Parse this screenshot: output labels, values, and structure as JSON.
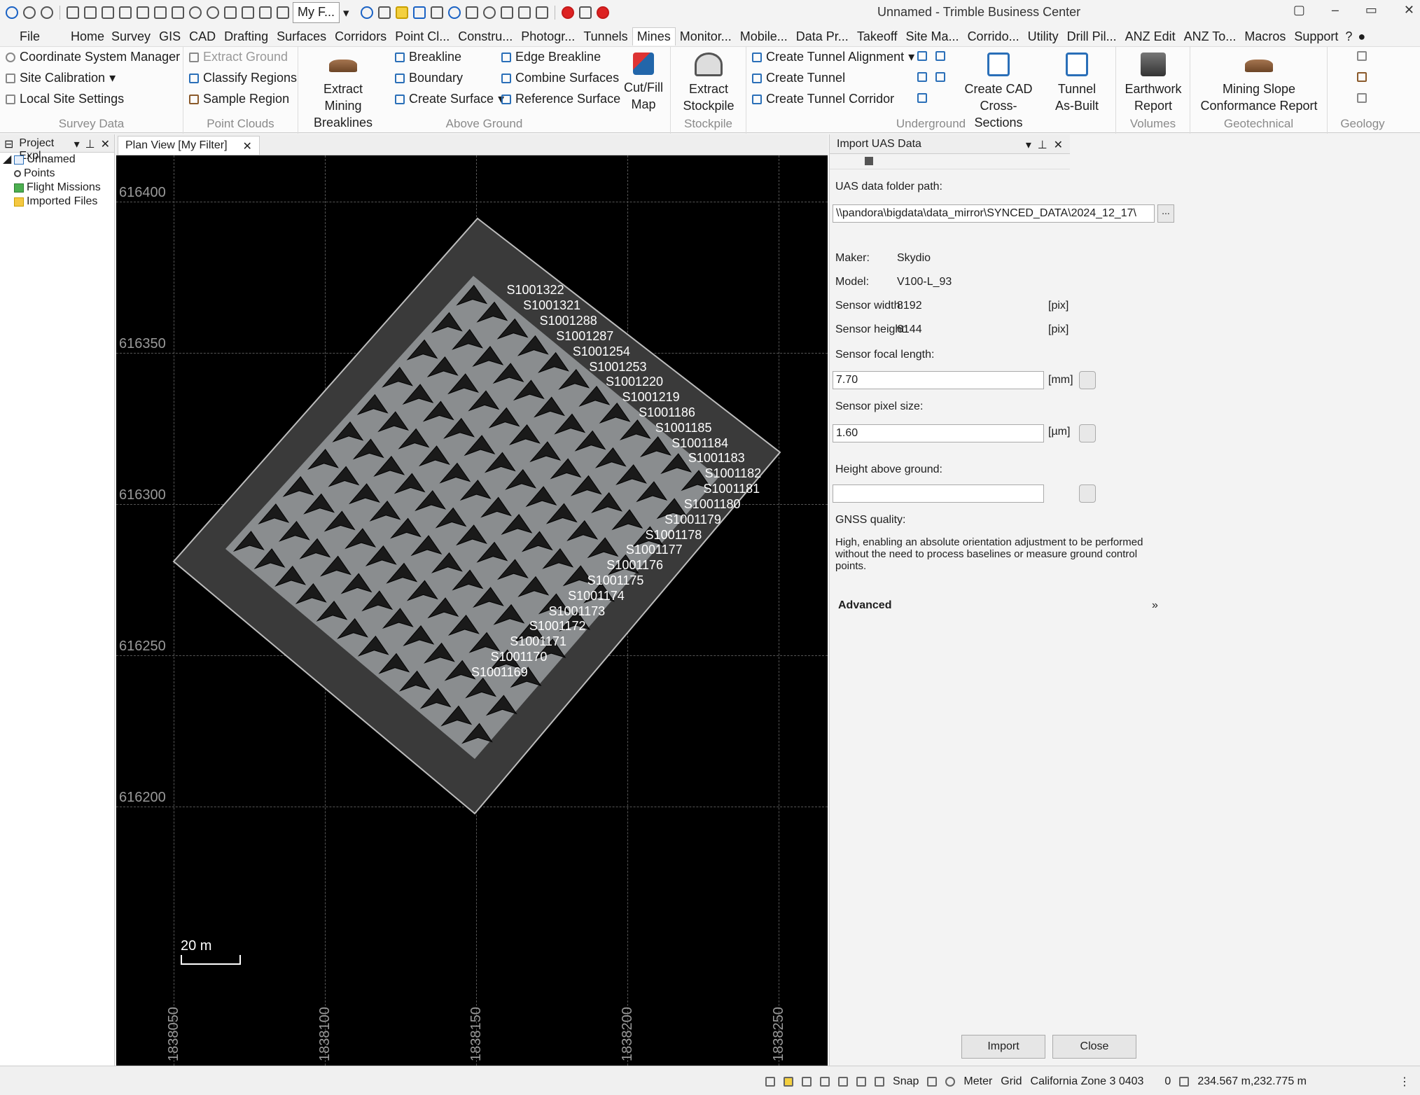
{
  "app": {
    "title": "Unnamed - Trimble Business Center",
    "filter_label": "My F...",
    "window_buttons": [
      "▢",
      "–",
      "▭",
      "✕"
    ]
  },
  "menu": {
    "items": [
      "File",
      "Home",
      "Survey",
      "GIS",
      "CAD",
      "Drafting",
      "Surfaces",
      "Corridors",
      "Point Cl...",
      "Constru...",
      "Photogr...",
      "Tunnels",
      "Mines",
      "Monitor...",
      "Mobile...",
      "Data Pr...",
      "Takeoff",
      "Site Ma...",
      "Corrido...",
      "Utility",
      "Drill Pil...",
      "ANZ Edit",
      "ANZ To...",
      "Macros",
      "Support"
    ],
    "active": "Mines",
    "help": "?"
  },
  "ribbon": {
    "survey_data": {
      "label": "Survey Data",
      "items": [
        "Coordinate System Manager",
        "Site Calibration",
        "Local Site Settings"
      ]
    },
    "point_clouds": {
      "label": "Point Clouds",
      "items": [
        "Extract Ground",
        "Classify Regions",
        "Sample Region"
      ]
    },
    "above_ground": {
      "label": "Above Ground",
      "big": "Extract Mining Breaklines",
      "col1": [
        "Breakline",
        "Boundary",
        "Create Surface"
      ],
      "col2": [
        "Edge Breakline",
        "Combine Surfaces",
        "Reference Surface"
      ],
      "cutfill": "Cut/Fill Map"
    },
    "stockpile": {
      "label": "Stockpile",
      "big": "Extract Stockpile"
    },
    "underground": {
      "label": "Underground",
      "items": [
        "Create Tunnel Alignment",
        "Create Tunnel",
        "Create Tunnel Corridor"
      ],
      "cad": "Create CAD Cross-Sections",
      "tunnel": "Tunnel As-Built"
    },
    "volumes": {
      "label": "Volumes",
      "big": "Earthwork Report"
    },
    "geotechnical": {
      "label": "Geotechnical",
      "big": "Mining Slope Conformance Report"
    },
    "geology": {
      "label": "Geology"
    }
  },
  "project_explorer": {
    "title": "Project Expl...",
    "root": "Unnamed",
    "children": [
      "Points",
      "Flight Missions",
      "Imported Files"
    ]
  },
  "plan_view": {
    "tab": "Plan View [My Filter]",
    "y_labels": [
      "616400",
      "616350",
      "616300",
      "616250",
      "616200"
    ],
    "x_labels": [
      "1838050",
      "1838100",
      "1838150",
      "1838200",
      "1838250"
    ],
    "scale": "20 m",
    "photo_labels": [
      "S1001322",
      "S1001321",
      "S1001288",
      "S1001287",
      "S1001254",
      "S1001253",
      "S1001220",
      "S1001219",
      "S1001186",
      "S1001185",
      "S1001184",
      "S1001183",
      "S1001182",
      "S1001181",
      "S1001180",
      "S1001179",
      "S1001178",
      "S1001177",
      "S1001176",
      "S1001175",
      "S1001174",
      "S1001173",
      "S1001172",
      "S1001171",
      "S1001170",
      "S1001169"
    ]
  },
  "import_panel": {
    "title": "Import UAS Data",
    "folder_label": "UAS data folder path:",
    "folder_value": "\\\\pandora\\bigdata\\data_mirror\\SYNCED_DATA\\2024_12_17\\",
    "browse": "...",
    "maker_label": "Maker:",
    "maker": "Skydio",
    "model_label": "Model:",
    "model": "V100-L_93",
    "sensor_width_label": "Sensor width:",
    "sensor_width": "8192",
    "sensor_height_label": "Sensor height:",
    "sensor_height": "6144",
    "pix_unit": "[pix]",
    "focal_label": "Sensor focal length:",
    "focal": "7.70",
    "focal_unit": "[mm]",
    "pixel_size_label": "Sensor pixel size:",
    "pixel_size": "1.60",
    "pixel_size_unit": "[µm]",
    "height_label": "Height above ground:",
    "height": "",
    "gnss_label": "GNSS quality:",
    "gnss_text": "High, enabling an absolute orientation adjustment to be performed without the need to process baselines or measure ground control points.",
    "advanced": "Advanced",
    "import_btn": "Import",
    "close_btn": "Close"
  },
  "status": {
    "snap": "Snap",
    "unit": "Meter",
    "grid": "Grid",
    "zone": "California Zone 3 0403",
    "zero": "0",
    "coords": "234.567 m,232.775 m"
  }
}
